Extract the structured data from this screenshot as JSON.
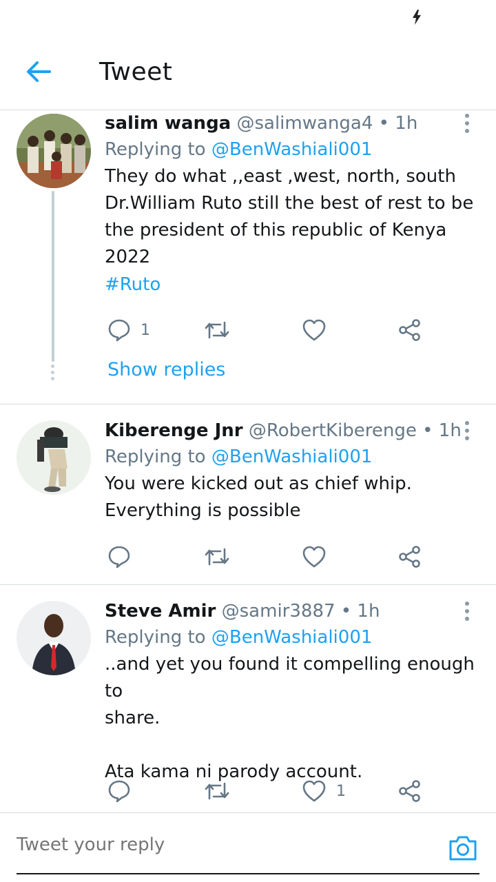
{
  "header": {
    "title": "Tweet"
  },
  "tweets": [
    {
      "name": "salim wanga",
      "handle": "@salimwanga4",
      "separator": "•",
      "time": "1h",
      "replying_prefix": "Replying to",
      "replying_to": "@BenWashiali001",
      "text": "They do what ,,east ,west, north, south\nDr.William Ruto still the best of rest to be\nthe president of this republic of Kenya\n2022",
      "hashtag": "#Ruto",
      "reply_count": "1",
      "retweet_count": "",
      "like_count": "",
      "show_replies": "Show replies"
    },
    {
      "name": "Kiberenge Jnr",
      "handle": "@RobertKiberenge",
      "separator": "•",
      "time": "1h",
      "replying_prefix": "Replying to",
      "replying_to": "@BenWashiali001",
      "text": "You were kicked out as chief whip.\nEverything is possible",
      "reply_count": "",
      "retweet_count": "",
      "like_count": ""
    },
    {
      "name": "Steve Amir",
      "handle": "@samir3887",
      "separator": "•",
      "time": "1h",
      "replying_prefix": "Replying to",
      "replying_to": "@BenWashiali001",
      "text": "..and yet you found it compelling enough to\nshare.\n\nAta kama ni parody account.",
      "reply_count": "",
      "retweet_count": "",
      "like_count": "1"
    }
  ],
  "composer": {
    "placeholder": "Tweet your reply"
  },
  "colors": {
    "accent": "#1da1f2",
    "muted": "#657786",
    "text": "#14171a",
    "divider": "#d6dbe0"
  },
  "icons": {
    "back": "arrow-left-icon",
    "reply": "reply-bubble-icon",
    "retweet": "retweet-icon",
    "like": "heart-icon",
    "share": "share-icon",
    "more": "more-vertical-icon",
    "camera": "camera-icon",
    "status": "lightning-bolt-icon"
  }
}
